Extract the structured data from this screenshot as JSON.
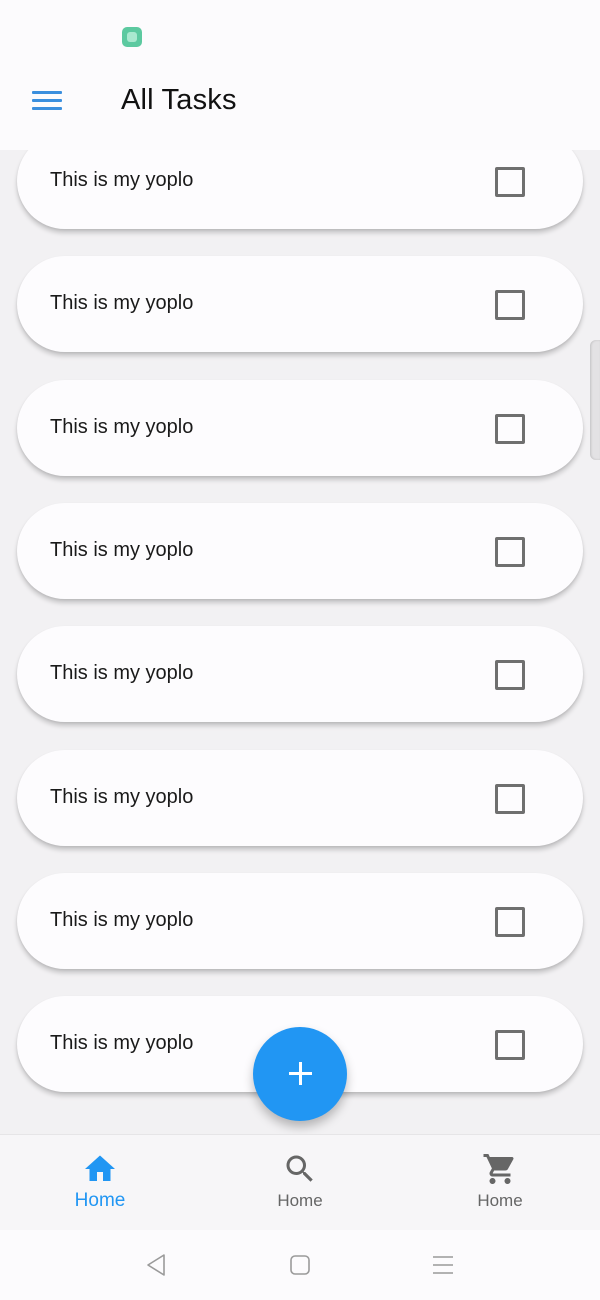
{
  "header": {
    "title": "All Tasks",
    "menu_icon": "hamburger-menu-icon",
    "accent_color": "#3b8fde"
  },
  "tasks": [
    {
      "label": "This is my yoplo",
      "checked": false
    },
    {
      "label": "This is my yoplo",
      "checked": false
    },
    {
      "label": "This is my yoplo",
      "checked": false
    },
    {
      "label": "This is my yoplo",
      "checked": false
    },
    {
      "label": "This is my yoplo",
      "checked": false
    },
    {
      "label": "This is my yoplo",
      "checked": false
    },
    {
      "label": "This is my yoplo",
      "checked": false
    },
    {
      "label": "This is my yoplo",
      "checked": false
    }
  ],
  "fab": {
    "icon": "plus-icon",
    "color": "#2196f3"
  },
  "bottom_nav": {
    "items": [
      {
        "label": "Home",
        "icon": "home-icon",
        "active": true
      },
      {
        "label": "Home",
        "icon": "search-icon",
        "active": false
      },
      {
        "label": "Home",
        "icon": "cart-icon",
        "active": false
      }
    ],
    "active_color": "#2196f3"
  },
  "system_nav": {
    "buttons": [
      "back-triangle-icon",
      "home-square-icon",
      "recents-lines-icon"
    ]
  }
}
